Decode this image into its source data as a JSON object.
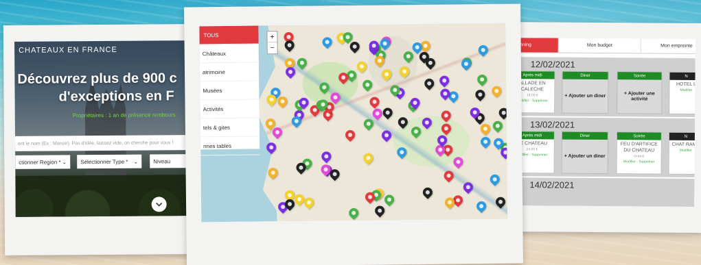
{
  "left_screen": {
    "brand": "CHATEAUX EN FRANCE",
    "title_line1": "Découvrez plus de 900 c",
    "title_line2": "d'exceptions en F",
    "subtitle": "Propriétaires : 1 an de présence rembours",
    "search_placeholder": "ent le nom (Ex : Manoir). Pas d'idée, laissez vide, on cherche pour vous !",
    "select_region": "ctionner Region *",
    "select_type": "Sélectionner Type *",
    "select_niveau": "Niveau"
  },
  "map_screen": {
    "menu": [
      "TOUS",
      "Châteaux",
      "atrimoine",
      "Musées",
      "Activités",
      "tels & gites",
      "nnes tables"
    ],
    "zoom_in": "+",
    "zoom_out": "−"
  },
  "planning_screen": {
    "tabs": [
      "nning",
      "Mon budget",
      "Mon empreinte"
    ],
    "days": [
      {
        "date": "12/02/2021",
        "cards": [
          {
            "header": "Après midi",
            "text": "ALLADE EN CALECHE",
            "price": "18,00 €",
            "modif": "Modifier - Supprimer"
          },
          {
            "header": "Diner",
            "add": "+ Ajouter un diner"
          },
          {
            "header": "Soirée",
            "add": "+ Ajouter une activité"
          },
          {
            "header": "N",
            "text": "HOTEL L",
            "modif": "Modifier"
          }
        ]
      },
      {
        "date": "13/02/2021",
        "cards": [
          {
            "header": "Après midi",
            "text": "DE CHATEAU",
            "price": "24,00 €",
            "modif": "Modifier - Supprimer"
          },
          {
            "header": "Diner",
            "add": "+ Ajouter un diner"
          },
          {
            "header": "Soirée",
            "text": "FEU D'ARTIFICE DU CHATEAU",
            "price": "Gratuit",
            "modif": "Modifier - Supprimer"
          },
          {
            "header": "N",
            "text": "CHAT RAMB",
            "modif": "Modifier"
          }
        ]
      },
      {
        "date": "14/02/2021"
      }
    ]
  },
  "icons": [
    "chevron-down-icon",
    "map-pin-icon"
  ],
  "colors": {
    "accent_red": "#e03a3e",
    "header_green": "#1f8b25",
    "subtitle_green": "#7bd146"
  }
}
